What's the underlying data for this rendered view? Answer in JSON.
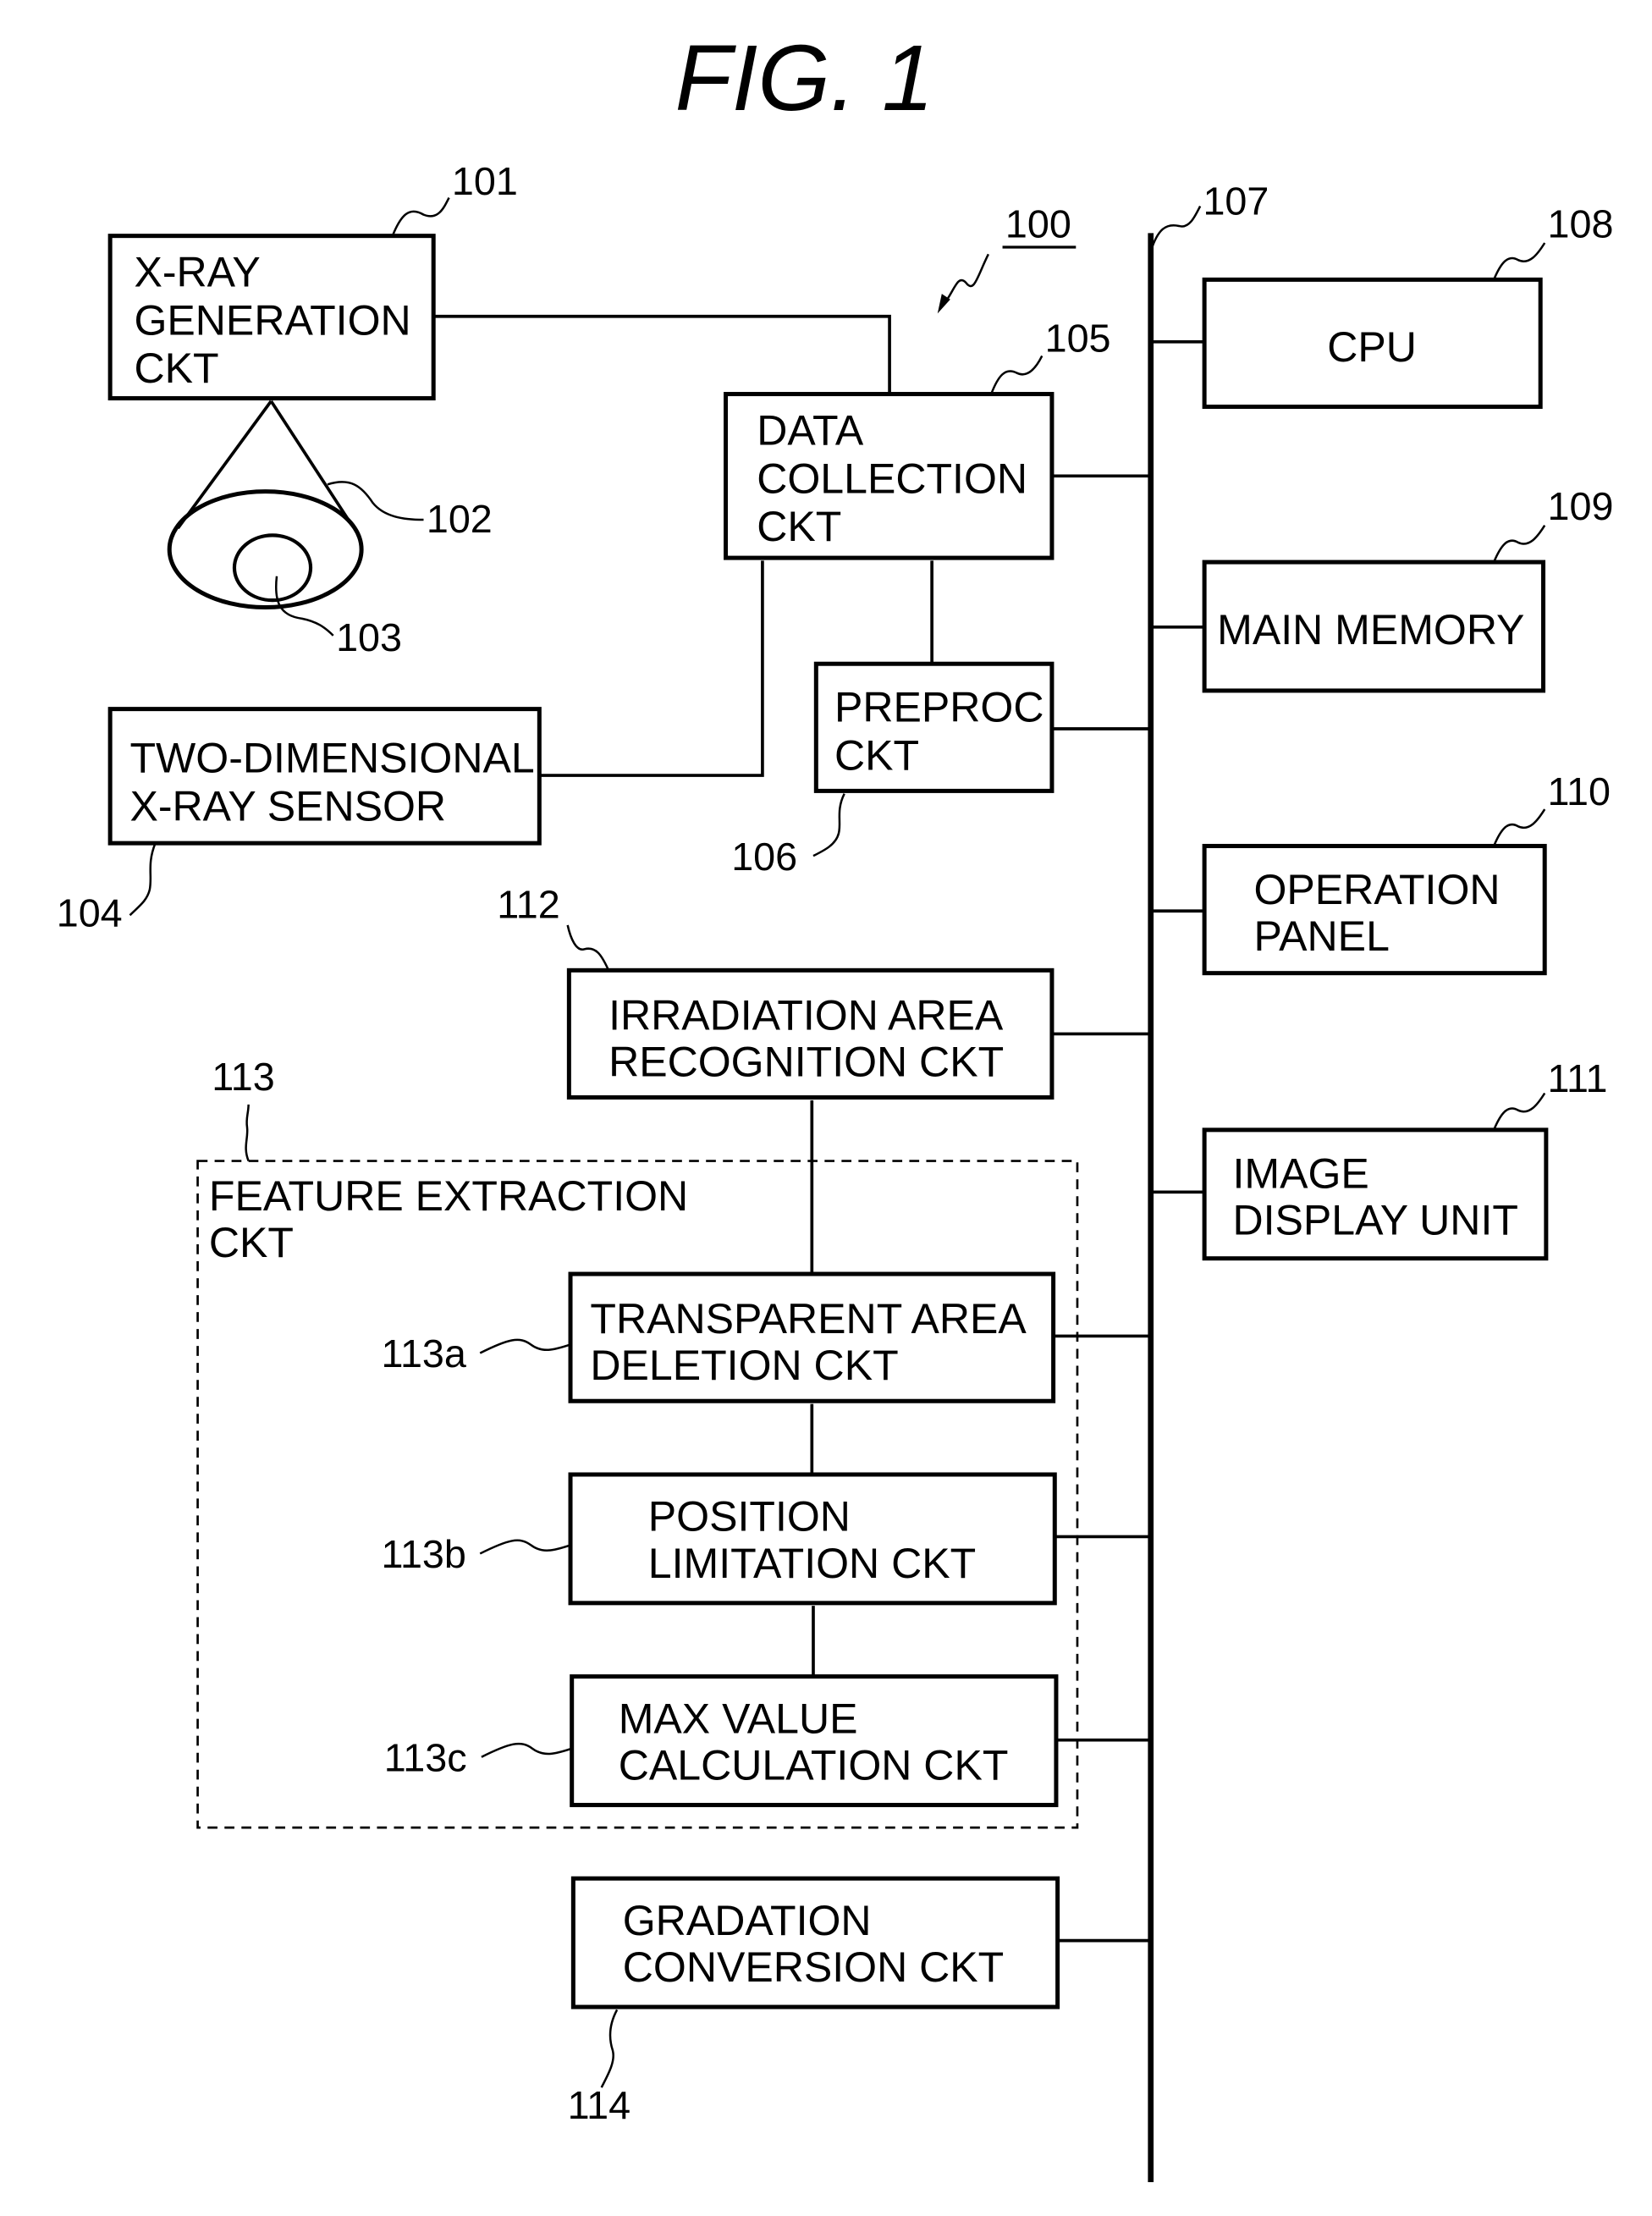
{
  "figure": {
    "title": "FIG. 1",
    "system_ref": "100",
    "bus_ref": "107"
  },
  "blocks": {
    "xray_gen": {
      "ref": "101",
      "lines": [
        "X-RAY",
        "GENERATION",
        "CKT"
      ]
    },
    "beam": {
      "ref": "102"
    },
    "object": {
      "ref": "103"
    },
    "sensor": {
      "ref": "104",
      "lines": [
        "TWO-DIMENSIONAL",
        "X-RAY  SENSOR"
      ]
    },
    "data_collection": {
      "ref": "105",
      "lines": [
        "DATA",
        "COLLECTION",
        "CKT"
      ]
    },
    "preproc": {
      "ref": "106",
      "lines": [
        "PREPROC",
        "CKT"
      ]
    },
    "cpu": {
      "ref": "108",
      "lines": [
        "CPU"
      ]
    },
    "main_memory": {
      "ref": "109",
      "lines": [
        "MAIN  MEMORY"
      ]
    },
    "operation_panel": {
      "ref": "110",
      "lines": [
        "OPERATION",
        "PANEL"
      ]
    },
    "image_display": {
      "ref": "111",
      "lines": [
        "IMAGE",
        "DISPLAY  UNIT"
      ]
    },
    "irradiation": {
      "ref": "112",
      "lines": [
        "IRRADIATION  AREA",
        "RECOGNITION  CKT"
      ]
    },
    "feature_extraction": {
      "ref": "113",
      "lines": [
        "FEATURE  EXTRACTION",
        "CKT"
      ]
    },
    "transparent": {
      "ref": "113a",
      "lines": [
        "TRANSPARENT  AREA",
        "DELETION  CKT"
      ]
    },
    "position": {
      "ref": "113b",
      "lines": [
        "POSITION",
        "LIMITATION  CKT"
      ]
    },
    "max_value": {
      "ref": "113c",
      "lines": [
        "MAX  VALUE",
        "CALCULATION  CKT"
      ]
    },
    "gradation": {
      "ref": "114",
      "lines": [
        "GRADATION",
        "CONVERSION  CKT"
      ]
    }
  }
}
